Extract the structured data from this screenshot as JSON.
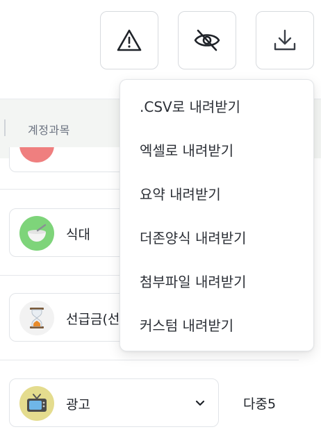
{
  "toolbar": {
    "buttons": [
      {
        "icon": "warning-icon"
      },
      {
        "icon": "eye-off-icon"
      },
      {
        "icon": "download-icon"
      }
    ]
  },
  "table": {
    "header": "계정과목",
    "rows": [
      {
        "category": "식대",
        "icon": "meal-icon",
        "icon_color": "#7ed47a"
      },
      {
        "category": "선급금(선급비용)",
        "icon": "hourglass-icon",
        "icon_color": "#f2f2f2"
      },
      {
        "category": "광고",
        "icon": "tv-icon",
        "icon_color": "#e4dc8e",
        "value": "다중5"
      }
    ],
    "partial_row_icon_color": "#ef7f7f"
  },
  "download_menu": {
    "items": [
      ".CSV로 내려받기",
      "엑셀로 내려받기",
      "요약 내려받기",
      "더존양식 내려받기",
      "첨부파일 내려받기",
      "커스텀 내려받기"
    ]
  }
}
